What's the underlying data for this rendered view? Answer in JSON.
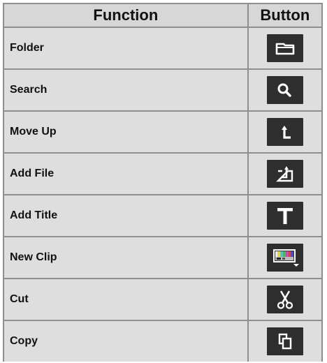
{
  "table": {
    "headers": {
      "function": "Function",
      "button": "Button"
    },
    "rows": [
      {
        "function": "Folder",
        "icon": "folder-icon"
      },
      {
        "function": "Search",
        "icon": "search-icon"
      },
      {
        "function": "Move Up",
        "icon": "move-up-icon"
      },
      {
        "function": "Add File",
        "icon": "add-file-icon"
      },
      {
        "function": "Add Title",
        "icon": "add-title-icon"
      },
      {
        "function": "New Clip",
        "icon": "new-clip-icon"
      },
      {
        "function": "Cut",
        "icon": "scissors-icon"
      },
      {
        "function": "Copy",
        "icon": "copy-icon"
      }
    ]
  },
  "colors": {
    "button_bg": "#2e2e2e",
    "icon": "#ffffff",
    "cell_bg": "#dedede",
    "header_bg": "#d7d7d7",
    "grid": "#8e8e8e"
  }
}
